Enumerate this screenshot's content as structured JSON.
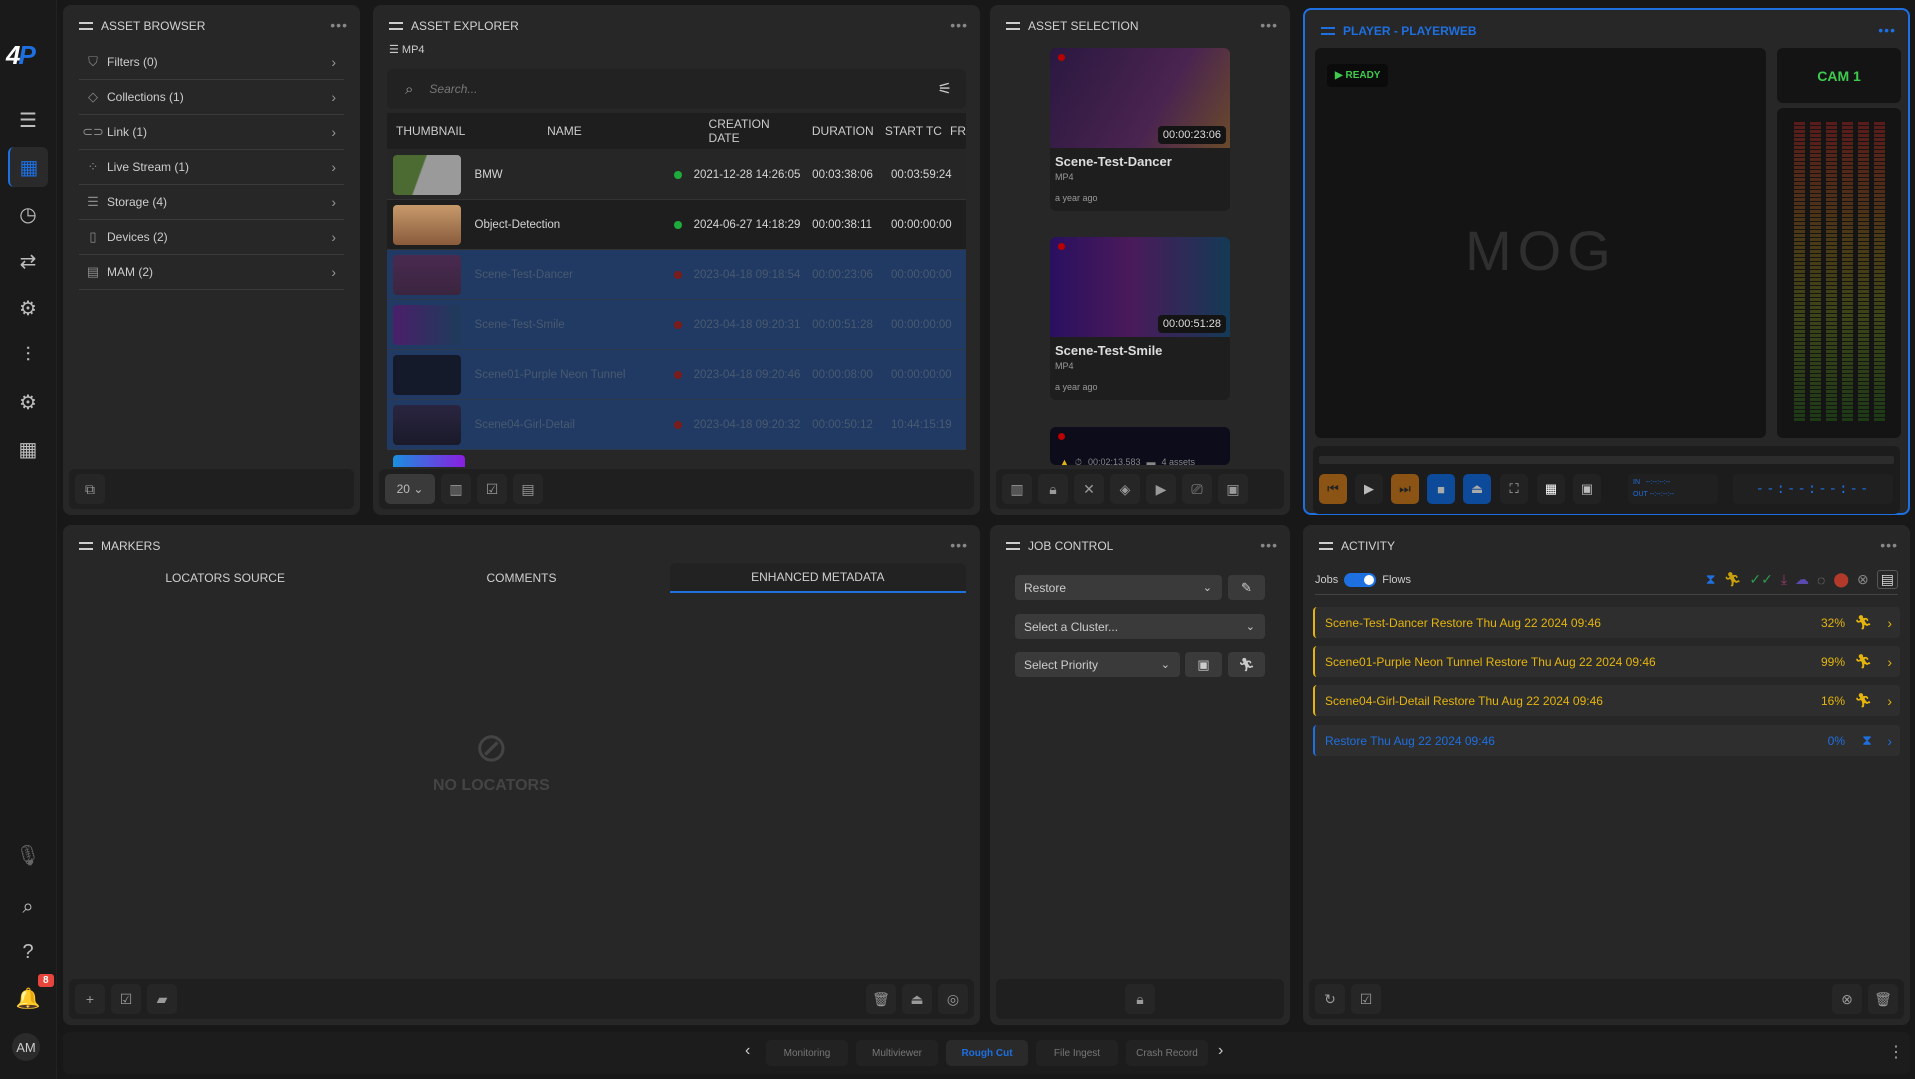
{
  "app": {
    "logo_a": "4",
    "logo_b": "P",
    "notifications": "8",
    "user_initials": "AM"
  },
  "sidebar": {
    "icons": [
      "menu-icon",
      "dashboard-icon",
      "history-icon",
      "transfer-icon",
      "workflow-settings-icon",
      "mixer-icon",
      "settings-icon",
      "grid-icon"
    ],
    "bottom_icons": [
      "mic-off-icon",
      "search-icon",
      "help-icon",
      "bell-icon"
    ]
  },
  "asset_browser": {
    "title": "ASSET BROWSER",
    "items": [
      {
        "label": "Filters (0)",
        "icon": "filter-icon"
      },
      {
        "label": "Collections (1)",
        "icon": "layers-icon"
      },
      {
        "label": "Link (1)",
        "icon": "link-icon"
      },
      {
        "label": "Live Stream (1)",
        "icon": "live-stream-icon"
      },
      {
        "label": "Storage (4)",
        "icon": "storage-icon"
      },
      {
        "label": "Devices (2)",
        "icon": "sd-card-icon"
      },
      {
        "label": "MAM (2)",
        "icon": "mam-icon"
      }
    ]
  },
  "asset_explorer": {
    "title": "ASSET EXPLORER",
    "filter_label": "MP4",
    "search_placeholder": "Search...",
    "columns": [
      "THUMBNAIL",
      "NAME",
      "CREATION DATE",
      "DURATION",
      "START TC",
      "FR"
    ],
    "rows": [
      {
        "name": "BMW",
        "status": "online",
        "date": "2021-12-28 14:26:05",
        "duration": "00:03:38:06",
        "start_tc": "00:03:59:24",
        "selected": false
      },
      {
        "name": "Object-Detection",
        "status": "online",
        "date": "2024-06-27 14:18:29",
        "duration": "00:00:38:11",
        "start_tc": "00:00:00:00",
        "selected": false
      },
      {
        "name": "Scene-Test-Dancer",
        "status": "offline",
        "date": "2023-04-18 09:18:54",
        "duration": "00:00:23:06",
        "start_tc": "00:00:00:00",
        "selected": true
      },
      {
        "name": "Scene-Test-Smile",
        "status": "offline",
        "date": "2023-04-18 09:20:31",
        "duration": "00:00:51:28",
        "start_tc": "00:00:00:00",
        "selected": true
      },
      {
        "name": "Scene01-Purple Neon Tunnel",
        "status": "offline",
        "date": "2023-04-18 09:20:46",
        "duration": "00:00:08:00",
        "start_tc": "00:00:00:00",
        "selected": true
      },
      {
        "name": "Scene04-Girl-Detail",
        "status": "offline",
        "date": "2023-04-18 09:20:32",
        "duration": "00:00:50:12",
        "start_tc": "10:44:15:19",
        "selected": true
      }
    ],
    "page_size": "20"
  },
  "asset_selection": {
    "title": "ASSET SELECTION",
    "cards": [
      {
        "name": "Scene-Test-Dancer",
        "format": "MP4",
        "age": "a year ago",
        "duration": "00:00:23:06"
      },
      {
        "name": "Scene-Test-Smile",
        "format": "MP4",
        "age": "a year ago",
        "duration": "00:00:51:28"
      }
    ],
    "summary_duration": "00:02:13.583",
    "summary_assets": "4 assets"
  },
  "player": {
    "title": "PLAYER - PLAYERWEB",
    "status": "READY",
    "logo_text": "MOG",
    "camera": "CAM 1",
    "in_label": "IN",
    "out_label": "OUT",
    "in_tc": "--:--:--:--",
    "out_tc": "--:--:--:--",
    "timecode": "--:--:--:--"
  },
  "markers": {
    "title": "MARKERS",
    "tabs": [
      "LOCATORS SOURCE",
      "COMMENTS",
      "ENHANCED METADATA"
    ],
    "active_tab": 2,
    "empty_text": "NO LOCATORS"
  },
  "job_control": {
    "title": "JOB CONTROL",
    "job_type": "Restore",
    "cluster_placeholder": "Select a Cluster...",
    "priority_placeholder": "Select Priority"
  },
  "activity": {
    "title": "ACTIVITY",
    "toggle_left": "Jobs",
    "toggle_right": "Flows",
    "items": [
      {
        "text": "Scene-Test-Dancer  Restore Thu Aug 22 2024 09:46",
        "progress": "32%",
        "state": "running"
      },
      {
        "text": "Scene01-Purple Neon Tunnel  Restore Thu Aug 22 2024 09:46",
        "progress": "99%",
        "state": "running"
      },
      {
        "text": "Scene04-Girl-Detail  Restore Thu Aug 22 2024 09:46",
        "progress": "16%",
        "state": "running"
      },
      {
        "text": "Restore Thu Aug 22 2024 09:46",
        "progress": "0%",
        "state": "queued"
      }
    ],
    "colors": {
      "running": "#e5b50d",
      "queued": "#1e6fe0"
    }
  },
  "bottom_nav": {
    "items": [
      "Monitoring",
      "Multiviewer",
      "Rough Cut",
      "File Ingest",
      "Crash Record"
    ],
    "active": "Rough Cut"
  }
}
